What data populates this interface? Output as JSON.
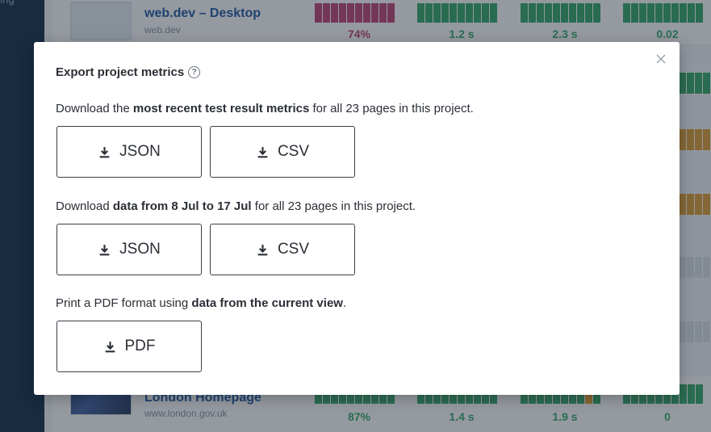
{
  "sidebar": {
    "partial_text": "ring"
  },
  "background_rows": [
    {
      "title": "web.dev – Desktop",
      "subtitle": "web.dev",
      "values": [
        "74%",
        "1.2 s",
        "2.3 s",
        "0.02"
      ]
    },
    {
      "title": "London Homepage",
      "subtitle": "www.london.gov.uk",
      "values": [
        "87%",
        "1.4 s",
        "1.9 s",
        "0"
      ]
    }
  ],
  "colors": {
    "good": "#3cab70",
    "poor": "#c2497a",
    "needs_improvement": "#e2a23c",
    "link": "#2a5fa8"
  },
  "modal": {
    "title": "Export project metrics",
    "help_icon": "?",
    "close_icon": "close-icon",
    "sections": [
      {
        "text_pre": "Download the ",
        "text_bold": "most recent test result metrics",
        "text_post": " for all 23 pages in this project.",
        "buttons": [
          {
            "label": "JSON",
            "icon": "download-icon"
          },
          {
            "label": "CSV",
            "icon": "download-icon"
          }
        ]
      },
      {
        "text_pre": "Download ",
        "text_bold": "data from 8 Jul to 17 Jul",
        "text_post": " for all 23 pages in this project.",
        "buttons": [
          {
            "label": "JSON",
            "icon": "download-icon"
          },
          {
            "label": "CSV",
            "icon": "download-icon"
          }
        ]
      },
      {
        "text_pre": "Print a PDF format using ",
        "text_bold": "data from the current view",
        "text_post": ".",
        "buttons": [
          {
            "label": "PDF",
            "icon": "download-icon"
          }
        ]
      }
    ]
  }
}
